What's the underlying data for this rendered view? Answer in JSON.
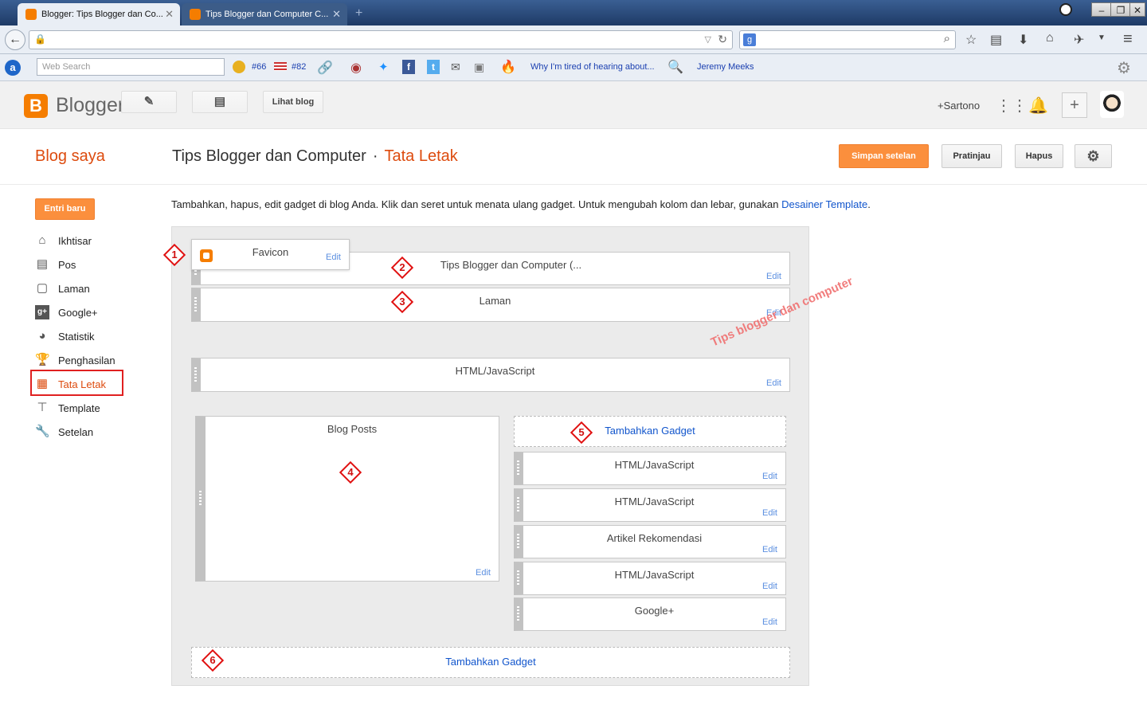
{
  "browser": {
    "tabs": [
      {
        "label": "Blogger: Tips Blogger dan Co...",
        "active": true
      },
      {
        "label": "Tips Blogger dan Computer C...",
        "active": false
      }
    ],
    "new_tab": "+",
    "window_controls": [
      "–",
      "❐",
      "✕"
    ],
    "bookmarks": {
      "web_search_placeholder": "Web Search",
      "rank1": "#66",
      "rank2": "#82",
      "news_link": "Why I'm tired of hearing about...",
      "person_link": "Jeremy Meeks"
    }
  },
  "header": {
    "logo_text": "Blogger",
    "view_blog": "Lihat blog",
    "user": "+Sartono"
  },
  "page": {
    "my_blog": "Blog saya",
    "blog_name": "Tips Blogger dan Computer",
    "separator": "·",
    "section": "Tata Letak",
    "save": "Simpan setelan",
    "preview": "Pratinjau",
    "delete": "Hapus"
  },
  "sidebar": {
    "new_post": "Entri baru",
    "items": [
      {
        "label": "Ikhtisar",
        "icon": "home-icon"
      },
      {
        "label": "Pos",
        "icon": "posts-icon"
      },
      {
        "label": "Laman",
        "icon": "pages-icon"
      },
      {
        "label": "Google+",
        "icon": "google-plus-icon"
      },
      {
        "label": "Statistik",
        "icon": "stats-icon"
      },
      {
        "label": "Penghasilan",
        "icon": "trophy-icon"
      },
      {
        "label": "Tata Letak",
        "icon": "layout-icon",
        "active": true
      },
      {
        "label": "Template",
        "icon": "paint-roller-icon"
      },
      {
        "label": "Setelan",
        "icon": "wrench-icon"
      }
    ]
  },
  "content": {
    "description": "Tambahkan, hapus, edit gadget di blog Anda. Klik dan seret untuk menata ulang gadget. Untuk mengubah kolom dan lebar, gunakan ",
    "description_link": "Desainer Template",
    "description_end": ".",
    "edit_label": "Edit",
    "gadgets": {
      "favicon": "Favicon",
      "header": "Tips Blogger dan Computer (...",
      "pages": "Laman",
      "html_top": "HTML/JavaScript",
      "blog_posts": "Blog Posts",
      "add_gadget_sidebar": "Tambahkan Gadget",
      "side1": "HTML/JavaScript",
      "side2": "HTML/JavaScript",
      "side3": "Artikel Rekomendasi",
      "side4": "HTML/JavaScript",
      "side5": "Google+",
      "add_gadget_footer": "Tambahkan Gadget"
    },
    "markers": [
      "1",
      "2",
      "3",
      "4",
      "5",
      "6"
    ],
    "watermark": "Tips blogger dan computer"
  },
  "colors": {
    "accent": "#dd4b0e",
    "button_orange": "#fb8f3d",
    "link": "#1155cc",
    "marker_red": "#e01010"
  }
}
